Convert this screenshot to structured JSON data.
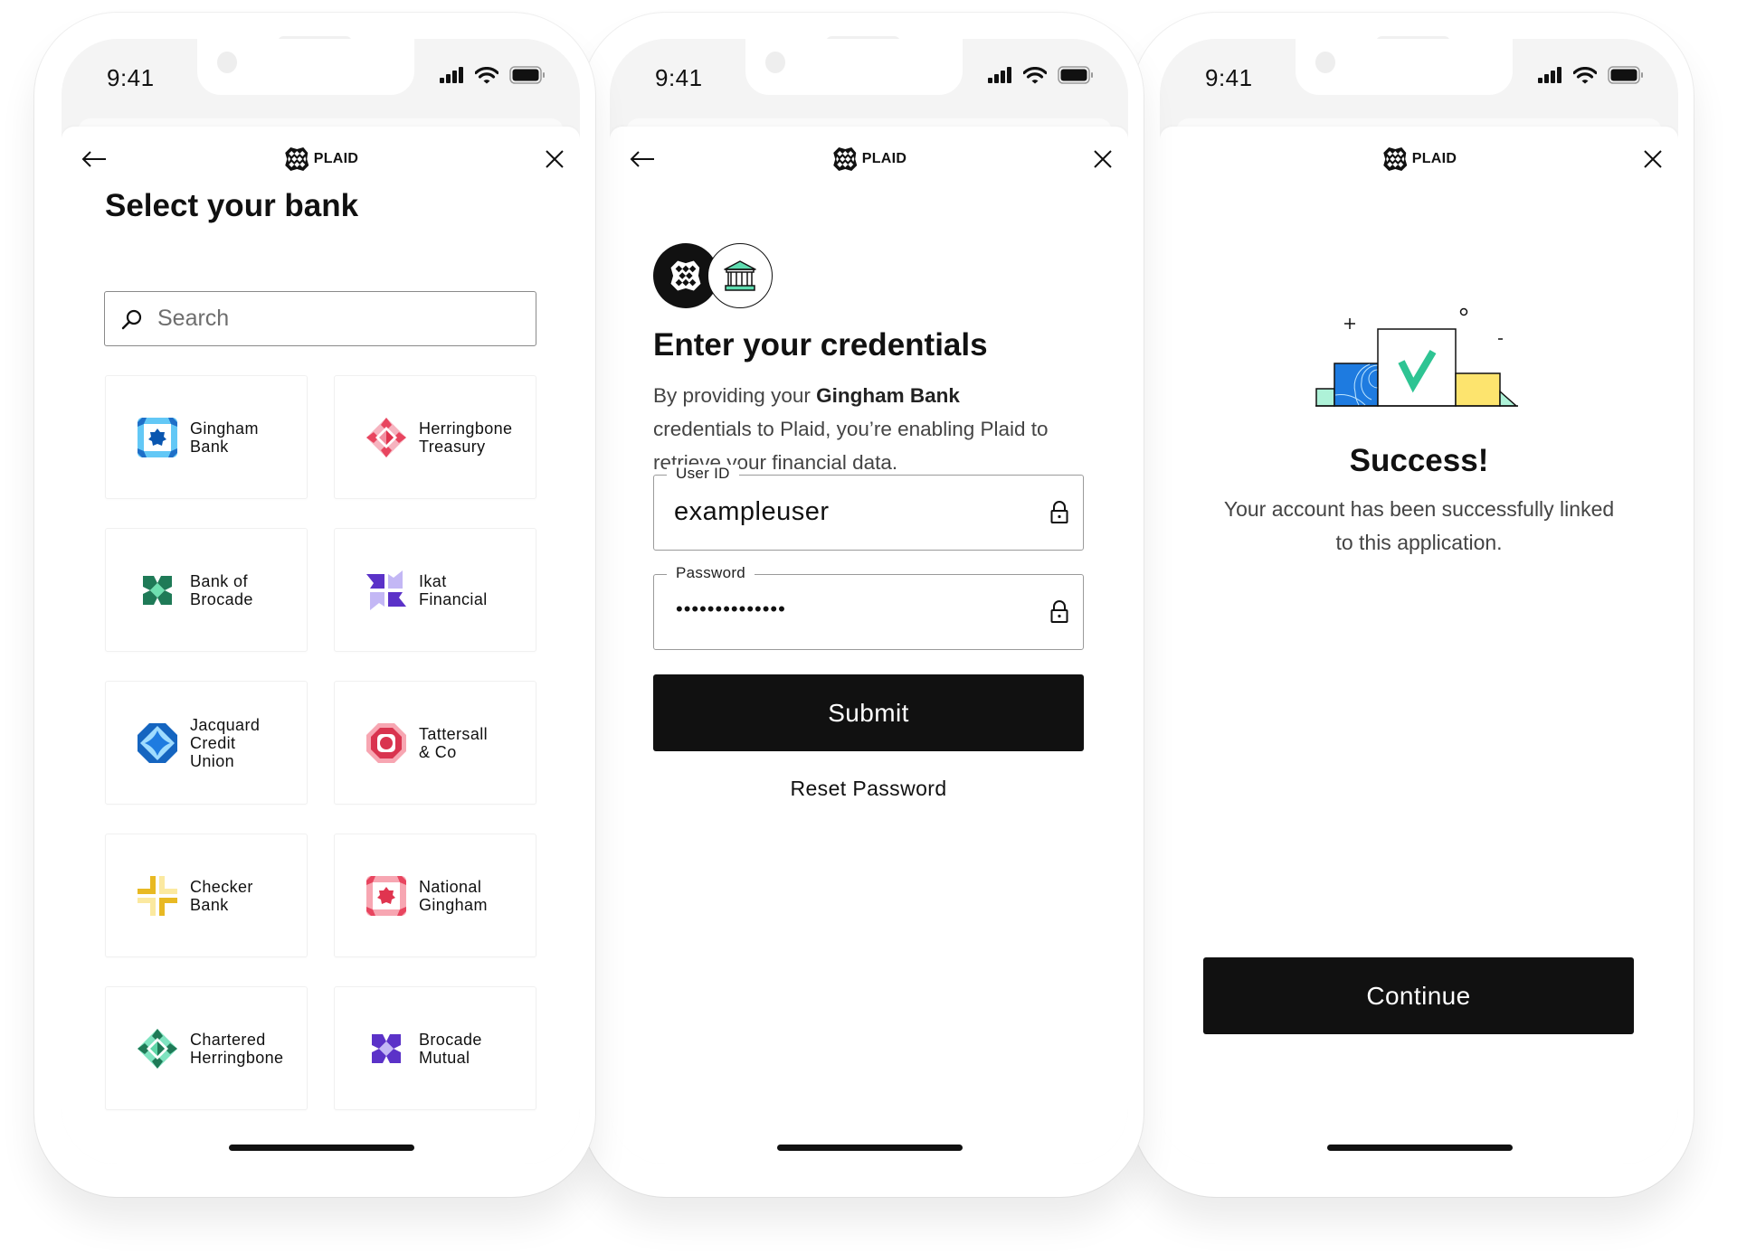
{
  "status_bar": {
    "time": "9:41"
  },
  "brand": {
    "logo_text": "PLAID",
    "accent": "#111111",
    "success_green": "#3ecf8e"
  },
  "screens": {
    "select_bank": {
      "title": "Select your bank",
      "search": {
        "placeholder": "Search",
        "value": ""
      },
      "banks": [
        {
          "name": "Gingham\nBank",
          "icon": "gingham-bank-logo"
        },
        {
          "name": "Herringbone\nTreasury",
          "icon": "herringbone-treasury-logo"
        },
        {
          "name": "Bank of\nBrocade",
          "icon": "bank-of-brocade-logo"
        },
        {
          "name": "Ikat\nFinancial",
          "icon": "ikat-financial-logo"
        },
        {
          "name": "Jacquard\nCredit\nUnion",
          "icon": "jacquard-credit-union-logo"
        },
        {
          "name": "Tattersall\n& Co",
          "icon": "tattersall-co-logo"
        },
        {
          "name": "Checker\nBank",
          "icon": "checker-bank-logo"
        },
        {
          "name": "National\nGingham",
          "icon": "national-gingham-logo"
        },
        {
          "name": "Chartered\nHerringbone",
          "icon": "chartered-herringbone-logo"
        },
        {
          "name": "Brocade\nMutual",
          "icon": "brocade-mutual-logo"
        }
      ]
    },
    "credentials": {
      "title": "Enter your credentials",
      "desc_prefix": "By providing your ",
      "desc_bank": "Gingham Bank",
      "desc_suffix": " credentials to Plaid, you’re enabling Plaid to retrieve your financial data.",
      "user_id": {
        "label": "User ID",
        "value": "exampleuser"
      },
      "password": {
        "label": "Password",
        "masked_value": "••••••••••••••"
      },
      "submit_label": "Submit",
      "reset_label": "Reset Password"
    },
    "success": {
      "title": "Success!",
      "message": "Your account has been successfully linked to this application.",
      "continue_label": "Continue"
    }
  }
}
